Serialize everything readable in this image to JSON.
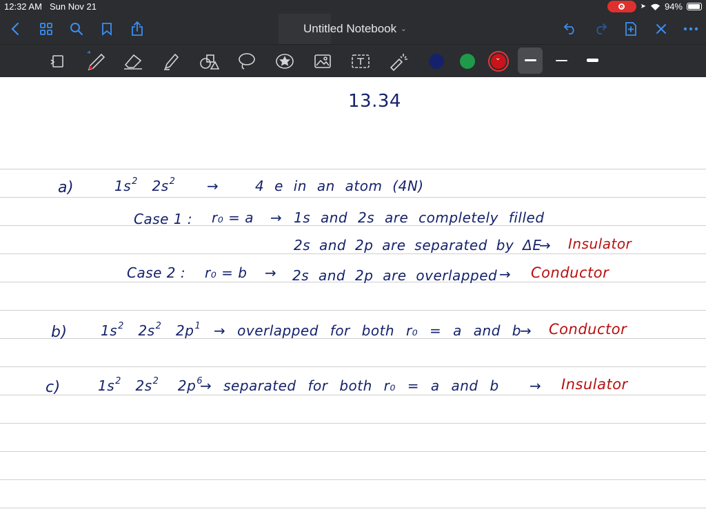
{
  "status": {
    "time": "12:32 AM",
    "date": "Sun Nov 21",
    "battery_percent": "94%",
    "battery_level": 0.94,
    "recording": true
  },
  "nav": {
    "title": "Untitled Notebook",
    "icons": [
      "back-chevron-icon",
      "grid-icon",
      "search-icon",
      "bookmark-icon",
      "share-icon",
      "undo-icon",
      "redo-icon",
      "add-page-icon",
      "close-icon",
      "more-icon"
    ]
  },
  "toolbar": {
    "tools": [
      "page-layout-icon",
      "pen-icon",
      "eraser-icon",
      "highlighter-icon",
      "shapes-icon",
      "lasso-icon",
      "sticker-icon",
      "image-icon",
      "text-icon",
      "laser-pointer-icon"
    ],
    "colors": {
      "navy": "#15226b",
      "green": "#1f9a4a",
      "red": "#c8141a"
    },
    "selected_color": "red"
  },
  "notes": {
    "title": "13.34",
    "a_label": "a)",
    "a_config": "1s 2s",
    "a_arrow": "→",
    "a_desc": "4 e in an atom (4N)",
    "case1_label": "Case 1 :",
    "case1_r": "r₀ = a",
    "case1_arrow": "→",
    "case1_line1": "1s and 2s are completely filled",
    "case1_line2": "2s and 2p are separated by ΔE",
    "case1_arrow2": "→",
    "case1_result": "Insulator",
    "case2_label": "Case 2 :",
    "case2_r": "r₀ = b",
    "case2_arrow": "→",
    "case2_desc": "2s and 2p are overlapped",
    "case2_arrow2": "→",
    "case2_result": "Conductor",
    "b_label": "b)",
    "b_config": "1s 2s 2p",
    "b_desc": "→ overlapped for both r₀ = a and b",
    "b_arrow": "→",
    "b_result": "Conductor",
    "c_label": "c)",
    "c_config": "1s 2s 2p",
    "c_desc": "→ separated for both r₀ = a and b",
    "c_arrow": "→",
    "c_result": "Insulator"
  }
}
